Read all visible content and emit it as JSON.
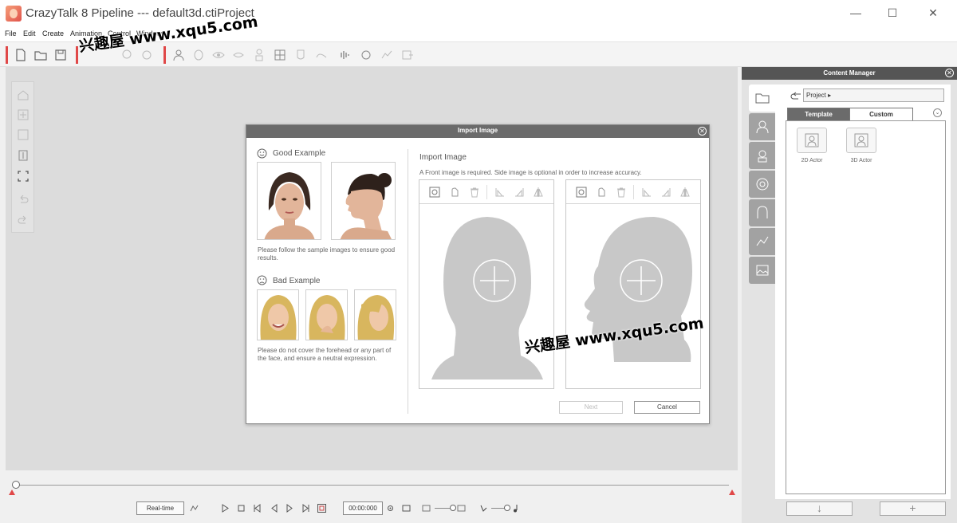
{
  "window": {
    "title": "CrazyTalk 8 Pipeline --- default3d.ctiProject",
    "minimize": "—",
    "maximize": "☐",
    "close": "✕"
  },
  "menu": [
    "File",
    "Edit",
    "Create",
    "Animation",
    "Control",
    "Window"
  ],
  "watermark": "兴趣屋 www.xqu5.com",
  "dialog": {
    "title": "Import Image",
    "good_example": {
      "heading": "Good Example",
      "hint": "Please follow the sample images to ensure good results."
    },
    "bad_example": {
      "heading": "Bad Example",
      "hint": "Please do not cover the forehead or any part of the face, and ensure a neutral expression."
    },
    "import": {
      "title": "Import Image",
      "description": "A Front image is required. Side image is optional in order to increase accuracy."
    },
    "buttons": {
      "next": "Next",
      "cancel": "Cancel"
    }
  },
  "content_manager": {
    "title": "Content Manager",
    "path": "Project ▸",
    "tabs": [
      "Template",
      "Custom"
    ],
    "active_tab": "Template",
    "items": [
      {
        "label": "2D Actor",
        "icon": "2d-actor-icon"
      },
      {
        "label": "3D Actor",
        "icon": "3d-actor-icon"
      }
    ],
    "footer": {
      "down": "↓",
      "add": "+"
    }
  },
  "timeline": {
    "mode_button": "Real-time",
    "time": "00:00:000"
  },
  "colors": {
    "accent": "#e04848",
    "header": "#6b6b6b",
    "viewport": "#dcdcdc"
  }
}
